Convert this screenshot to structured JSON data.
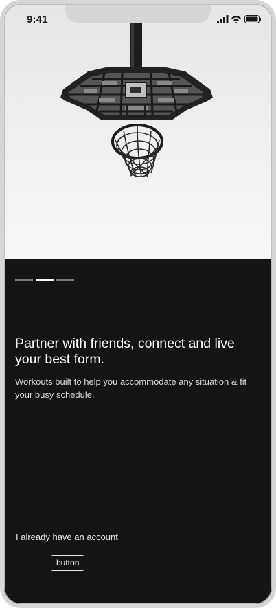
{
  "status_bar": {
    "time": "9:41",
    "icons": [
      "cellular-signal-icon",
      "wifi-icon",
      "battery-icon"
    ]
  },
  "hero": {
    "image": "basketball-hoop-photo"
  },
  "pager": {
    "count": 3,
    "active_index": 1
  },
  "onboarding": {
    "headline": "Partner with friends, connect and live your best form.",
    "subtext": "Workouts built to help you accommodate any situation & fit your busy schedule."
  },
  "actions": {
    "login_link": "I already have an account",
    "button_label": "button"
  },
  "colors": {
    "background": "#141414",
    "text_primary": "#ffffff",
    "frame": "#d6d6d6"
  }
}
